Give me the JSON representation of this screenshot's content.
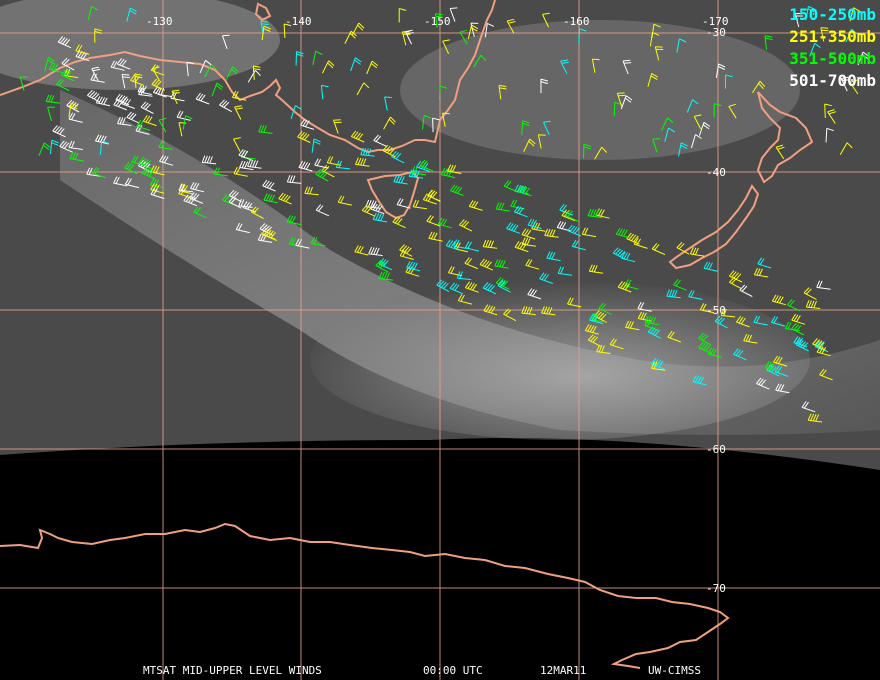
{
  "map": {
    "lon_labels": [
      "-130",
      "-140",
      "-150",
      "-160",
      "-170"
    ],
    "lat_labels": [
      "-30",
      "-40",
      "-50",
      "-60",
      "-70"
    ],
    "grid_color": "#e8a38a",
    "coast_color": "#f0a080"
  },
  "legend": {
    "items": [
      {
        "label": "150-250mb",
        "color": "#00ffff"
      },
      {
        "label": "251-350mb",
        "color": "#ffff00"
      },
      {
        "label": "351-500mb",
        "color": "#00ff00"
      },
      {
        "label": "501-700mb",
        "color": "#ffffff"
      }
    ]
  },
  "footer": {
    "product": "MTSAT MID-UPPER LEVEL WINDS",
    "time": "00:00 UTC",
    "date": "12MAR11",
    "source": "UW-CIMSS"
  }
}
